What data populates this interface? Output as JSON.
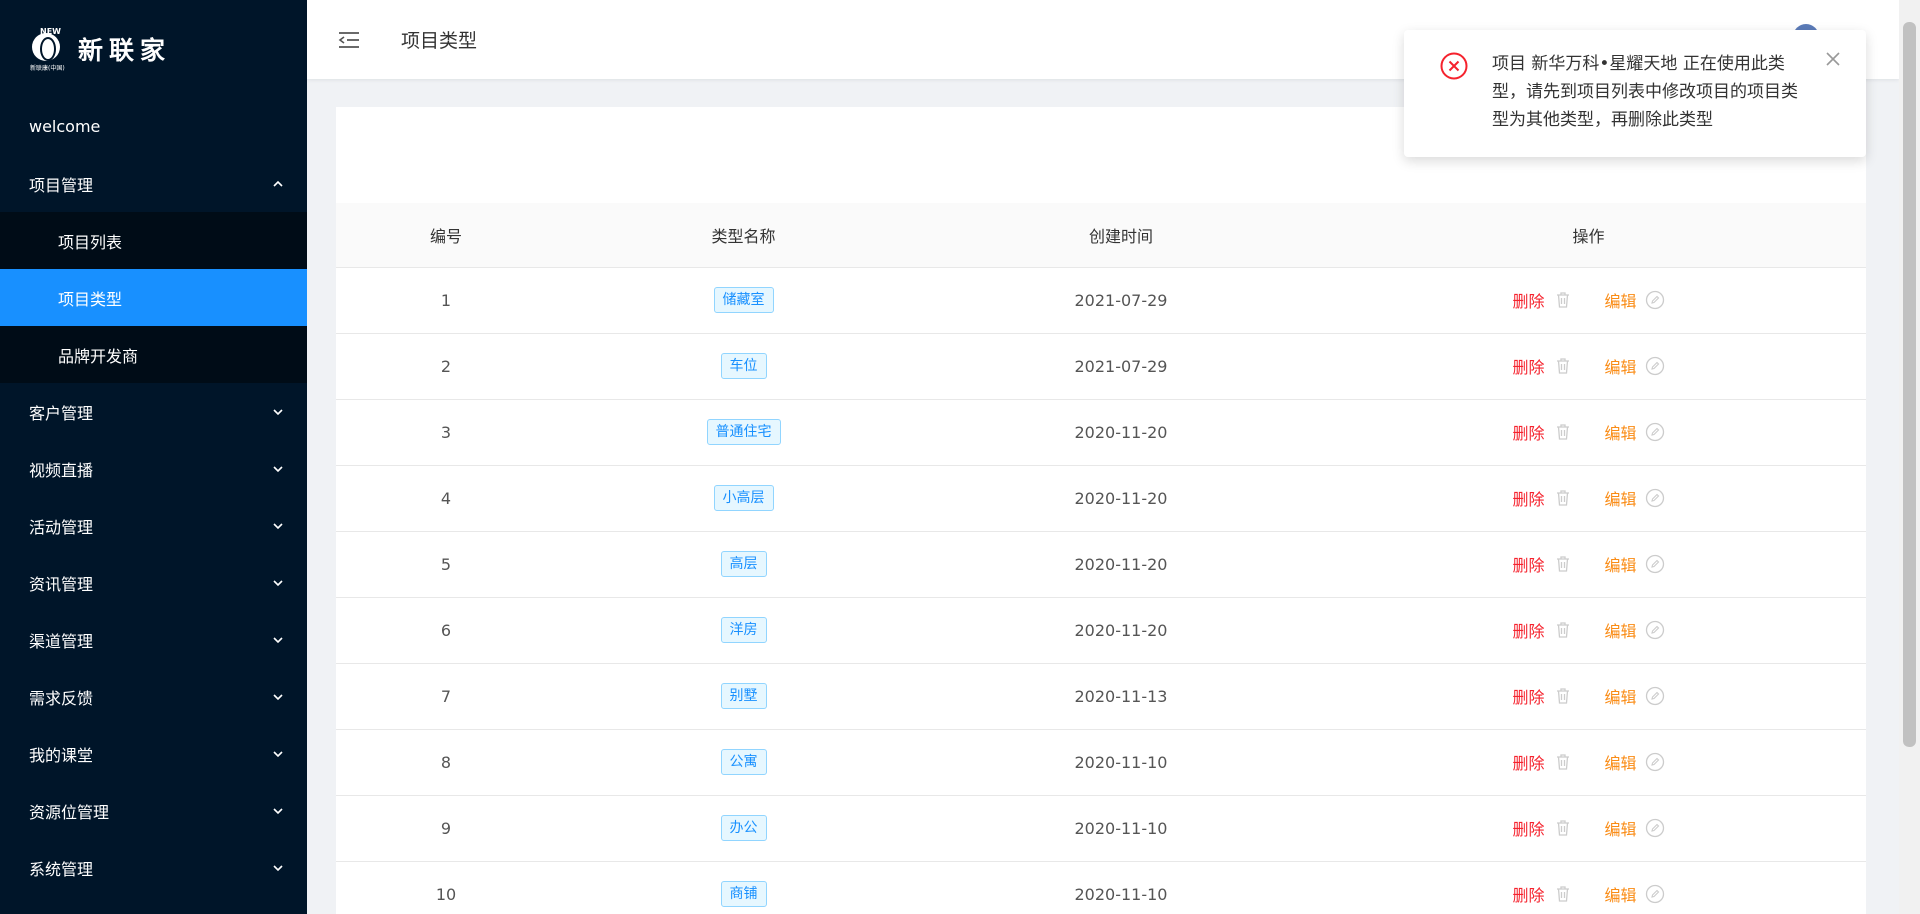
{
  "brand": {
    "logo_text": "新联家",
    "logo_new": "NEW",
    "logo_sub": "新联康(中国)"
  },
  "sidebar": {
    "welcome": "welcome",
    "project_mgmt": {
      "label": "项目管理",
      "children": [
        "项目列表",
        "项目类型",
        "品牌开发商"
      ],
      "active": "项目类型"
    },
    "items": [
      "客户管理",
      "视频直播",
      "活动管理",
      "资讯管理",
      "渠道管理",
      "需求反馈",
      "我的课堂",
      "资源位管理",
      "系统管理"
    ]
  },
  "header": {
    "title": "项目类型"
  },
  "table": {
    "headers": [
      "编号",
      "类型名称",
      "创建时间",
      "操作"
    ],
    "delete_label": "删除",
    "edit_label": "编辑",
    "rows": [
      {
        "no": "1",
        "type": "储藏室",
        "time": "2021-07-29"
      },
      {
        "no": "2",
        "type": "车位",
        "time": "2021-07-29"
      },
      {
        "no": "3",
        "type": "普通住宅",
        "time": "2020-11-20"
      },
      {
        "no": "4",
        "type": "小高层",
        "time": "2020-11-20"
      },
      {
        "no": "5",
        "type": "高层",
        "time": "2020-11-20"
      },
      {
        "no": "6",
        "type": "洋房",
        "time": "2020-11-20"
      },
      {
        "no": "7",
        "type": "别墅",
        "time": "2020-11-13"
      },
      {
        "no": "8",
        "type": "公寓",
        "time": "2020-11-10"
      },
      {
        "no": "9",
        "type": "办公",
        "time": "2020-11-10"
      },
      {
        "no": "10",
        "type": "商铺",
        "time": "2020-11-10"
      }
    ]
  },
  "notification": {
    "type": "error",
    "message": "项目 新华万科•星耀天地 正在使用此类型，请先到项目列表中修改项目的项目类型为其他类型，再删除此类型"
  },
  "colors": {
    "sidebar_bg": "#001529",
    "active": "#1890ff",
    "delete": "#f5222d",
    "edit": "#fa8c16",
    "error": "#f5222d"
  }
}
